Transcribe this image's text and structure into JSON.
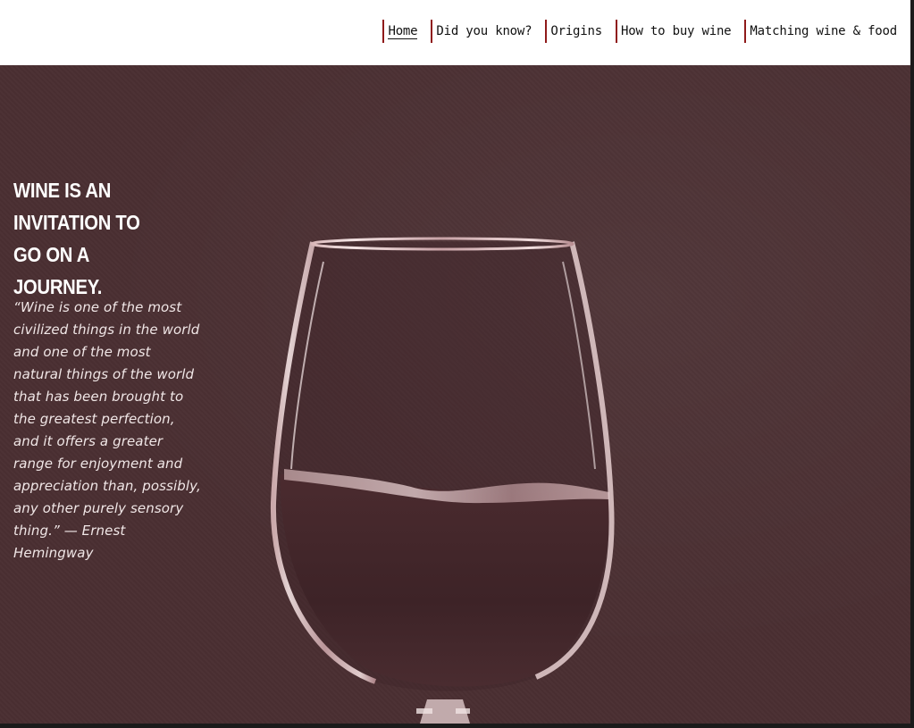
{
  "nav": {
    "items": [
      {
        "label": "Home",
        "active": true
      },
      {
        "label": "Did you know?",
        "active": false
      },
      {
        "label": "Origins",
        "active": false
      },
      {
        "label": "How to buy wine",
        "active": false
      },
      {
        "label": "Matching wine & food",
        "active": false
      }
    ]
  },
  "hero": {
    "heading": "WINE IS AN INVITATION TO GO ON A JOURNEY.",
    "quote": "“Wine is one of the most civilized things in the world and one of the most natural things of the world that has been brought to the greatest perfection, and it offers a greater range for enjoyment and appreciation than, possibly, any other purely sensory thing.” — Ernest Hemingway"
  },
  "colors": {
    "background": "#4a2f32",
    "header": "#ffffff",
    "nav_accent": "#8f1a1a",
    "text_light": "#ffffff"
  }
}
